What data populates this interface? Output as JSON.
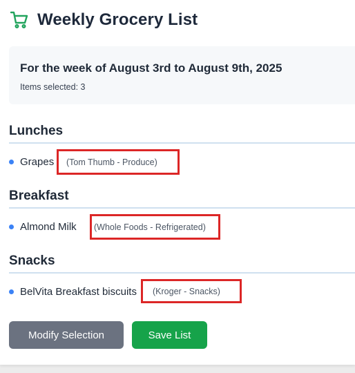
{
  "header": {
    "title": "Weekly Grocery List",
    "icon": "shopping-cart-icon",
    "icon_color": "#22a45d"
  },
  "week": {
    "title": "For the week of August 3rd to August 9th, 2025",
    "selected_count": "Items selected: 3"
  },
  "sections": [
    {
      "title": "Lunches",
      "items": [
        {
          "name": "Grapes",
          "note": "(Tom Thumb - Produce)"
        }
      ]
    },
    {
      "title": "Breakfast",
      "items": [
        {
          "name": "Almond Milk",
          "note": "(Whole Foods - Refrigerated)"
        }
      ]
    },
    {
      "title": "Snacks",
      "items": [
        {
          "name": "BelVita Breakfast biscuits",
          "note": "(Kroger - Snacks)"
        }
      ]
    }
  ],
  "actions": {
    "modify_label": "Modify Selection",
    "save_label": "Save List"
  },
  "colors": {
    "bullet": "#3b82f6",
    "highlight_border": "#dc2626",
    "modify_button": "#6b7280",
    "save_button": "#16a34a"
  }
}
